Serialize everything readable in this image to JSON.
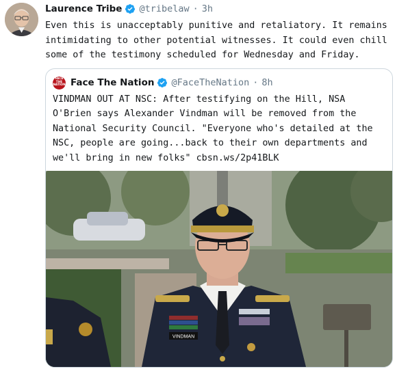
{
  "tweet": {
    "author_name": "Laurence Tribe",
    "author_handle": "@tribelaw",
    "time": "3h",
    "text": "Even this is unacceptably punitive and retaliatory. It remains intimidating to other potential witnesses. It could even chill some of the testimony scheduled for Wednesday and Friday."
  },
  "quoted": {
    "avatar_lines": [
      "FACE",
      "THE",
      "NATION"
    ],
    "author_name": "Face The Nation",
    "author_handle": "@FaceTheNation",
    "time": "8h",
    "text": "VINDMAN OUT AT NSC: After testifying on the Hill, NSA O'Brien says Alexander Vindman will be removed from the National Security Council. \"Everyone who's detailed at the NSC, people are going...back to their own departments and we'll bring in new folks\" cbsn.ws/2p41BLK",
    "photo": {
      "name_tag": "VINDMAN"
    }
  },
  "icons": {
    "verified": "verified-badge-icon"
  },
  "colors": {
    "verified": "#1da1f2",
    "secondary_text": "#657786",
    "border": "#ccd6dd",
    "cbs_red": "#b8141c"
  }
}
